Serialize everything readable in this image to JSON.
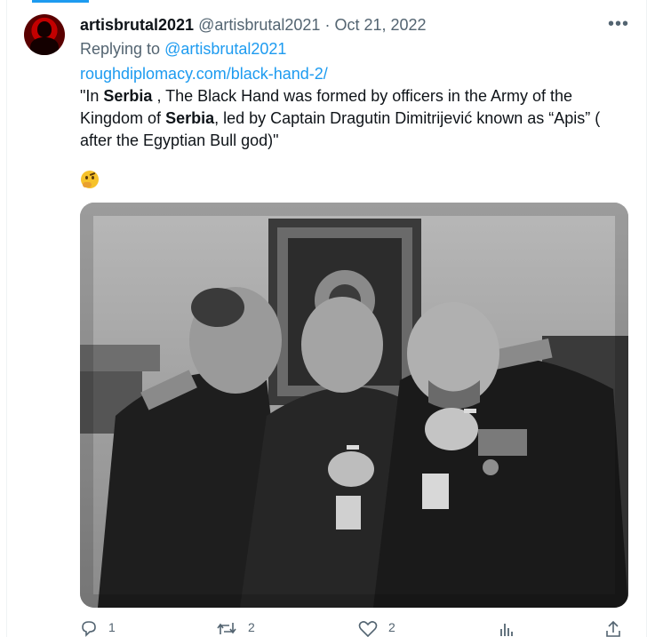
{
  "tweet": {
    "display_name": "artisbrutal2021",
    "handle": "@artisbrutal2021",
    "separator": "·",
    "date": "Oct 21, 2022",
    "replying_prefix": "Replying to",
    "replying_to": "@artisbrutal2021",
    "link": "roughdiplomacy.com/black-hand-2/",
    "text_segments": [
      "\"In ",
      "Serbia",
      " , The Black Hand was formed by officers in the Army of the Kingdom of ",
      "Serbia",
      ", led by Captain Dragutin Dimitrijević known as “Apis” ( after the Egyptian Bull god)\""
    ],
    "emoji": "thinking-face-emoji"
  },
  "actions": {
    "reply_count": "1",
    "retweet_count": "2",
    "like_count": "2",
    "views_count": ""
  },
  "icons": {
    "more": "more-horizontal-icon",
    "reply": "reply-icon",
    "retweet": "retweet-icon",
    "like": "heart-icon",
    "views": "views-chart-icon",
    "share": "share-icon"
  },
  "colors": {
    "accent": "#1d9bf0",
    "secondary_text": "#536471",
    "primary_text": "#0f1419"
  }
}
